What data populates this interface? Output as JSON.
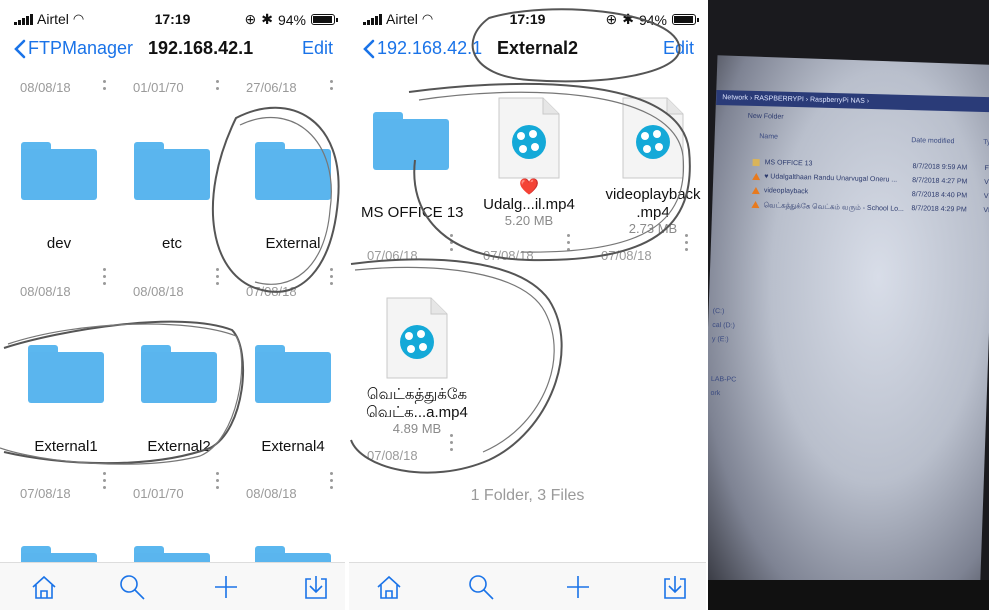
{
  "status": {
    "carrier": "Airtel",
    "time": "17:19",
    "battery": "94%",
    "battery_level": 0.94
  },
  "left": {
    "nav": {
      "back": "FTPManager",
      "title": "192.168.42.1",
      "edit": "Edit"
    },
    "top_dates": [
      "08/08/18",
      "01/01/70",
      "27/06/18"
    ],
    "rows": [
      {
        "items": [
          {
            "name": "dev"
          },
          {
            "name": "etc"
          },
          {
            "name": "External"
          }
        ],
        "dates": [
          "08/08/18",
          "08/08/18",
          "07/08/18"
        ]
      },
      {
        "items": [
          {
            "name": "External1"
          },
          {
            "name": "External2"
          },
          {
            "name": "External4"
          }
        ],
        "dates": [
          "07/08/18",
          "01/01/70",
          "08/08/18"
        ]
      }
    ]
  },
  "right": {
    "nav": {
      "back": "192.168.42.1",
      "title": "External2",
      "edit": "Edit"
    },
    "items": [
      {
        "name": "MS OFFICE 13",
        "date": "07/06/18",
        "type": "folder"
      },
      {
        "name": "Udalg...il.mp4",
        "size": "5.20 MB",
        "date": "07/08/18",
        "type": "video",
        "emoji": "❤️"
      },
      {
        "name": "videoplayback .mp4",
        "line1": "videoplayback",
        "line2": ".mp4",
        "size": "2.73 MB",
        "date": "07/08/18",
        "type": "video"
      },
      {
        "name": "வெட்கத்துக்கே வெட்க...a.mp4",
        "line1": "வெட்கத்துக்கே",
        "line2": "வெட்க...a.mp4",
        "size": "4.89 MB",
        "date": "07/08/18",
        "type": "video"
      }
    ],
    "summary": "1 Folder, 3 Files"
  },
  "toolbar": {
    "icons": [
      "home-icon",
      "search-icon",
      "plus-icon",
      "download-icon"
    ]
  },
  "photo": {
    "breadcrumb": "Network › RASPBERRYPI › RaspberryPi NAS ›",
    "new_folder": "New Folder",
    "col_name": "Name",
    "col_date": "Date modified",
    "col_type": "Typ",
    "files": [
      {
        "name": "MS OFFICE 13",
        "date": "8/7/2018 9:59 AM",
        "type": "File",
        "icon": "folder"
      },
      {
        "name": "♥ Udalgalthaan Randu Unarvugal Oneru ...",
        "date": "8/7/2018 4:27 PM",
        "type": "VLC",
        "icon": "vlc"
      },
      {
        "name": "videoplayback",
        "date": "8/7/2018 4:40 PM",
        "type": "VLC",
        "icon": "vlc"
      },
      {
        "name": "வெட்கத்துக்கே வெட்கம் வரும் - School Lo...",
        "date": "8/7/2018 4:29 PM",
        "type": "VLC",
        "icon": "vlc"
      }
    ],
    "sidebar": [
      "(C:)",
      "cal (D:)",
      "y (E:)",
      "LAB-PC",
      "ork"
    ]
  },
  "colors": {
    "accent": "#1a73e8",
    "folder": "#5ab5ee",
    "muted": "#9a9a9a"
  }
}
